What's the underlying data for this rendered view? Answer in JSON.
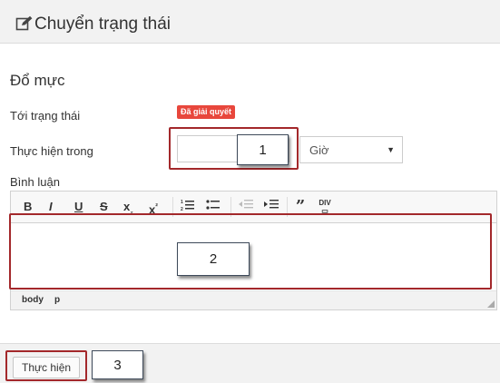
{
  "header": {
    "title": "Chuyển trạng thái",
    "icon": "edit-icon"
  },
  "form": {
    "section_title": "Đổ mực",
    "to_status_label": "Tới trạng thái",
    "to_status_value": "Đã giải quyết",
    "duration_label": "Thực hiện trong",
    "duration_value": "",
    "unit_value": "Giờ",
    "comment_label": "Bình luận"
  },
  "editor": {
    "toolbar": [
      "bold-icon",
      "italic-icon",
      "underline-icon",
      "strikethrough-icon",
      "subscript-icon",
      "superscript-icon",
      "numbered-list-icon",
      "bulleted-list-icon",
      "decrease-indent-icon",
      "increase-indent-icon",
      "blockquote-icon",
      "div-icon"
    ],
    "statusbar": {
      "path1": "body",
      "path2": "p"
    }
  },
  "footer": {
    "submit_label": "Thực hiện"
  },
  "callouts": {
    "c1": "1",
    "c2": "2",
    "c3": "3"
  },
  "colors": {
    "badge": "#e8473c",
    "highlight": "#a3282b"
  }
}
